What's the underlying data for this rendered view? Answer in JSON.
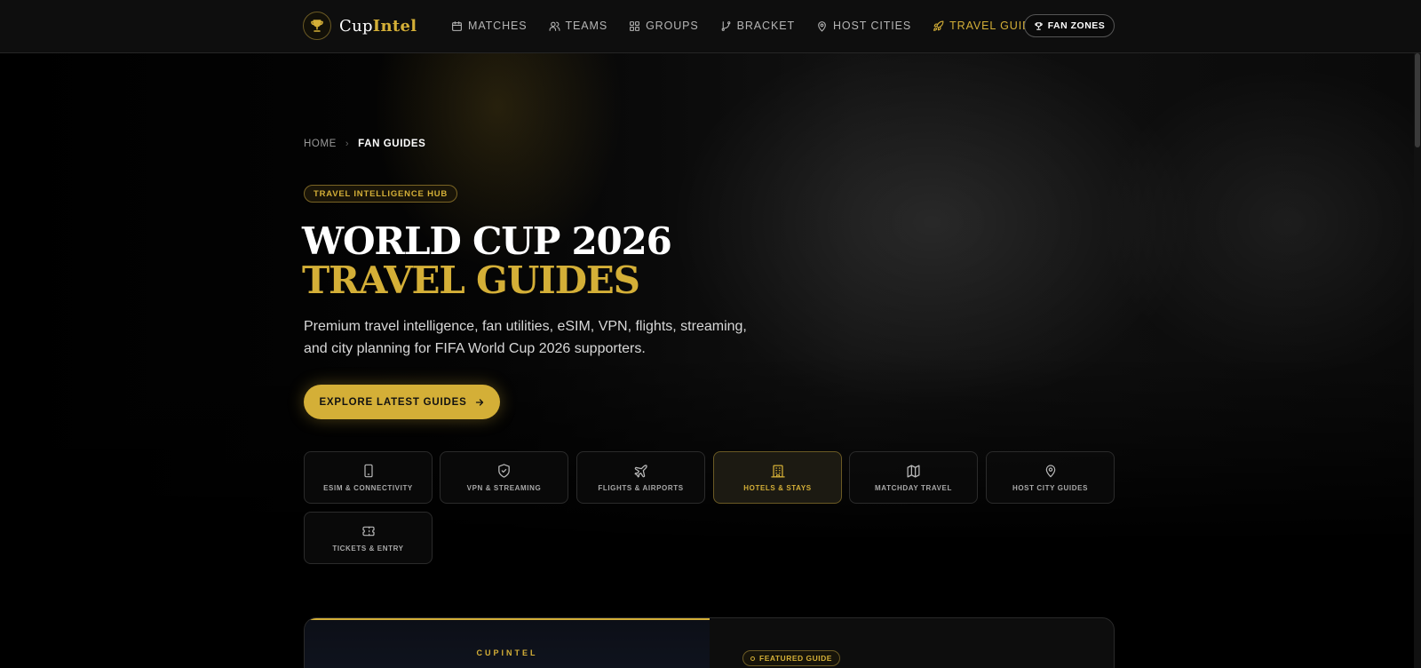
{
  "nav": {
    "logo": {
      "part1": "Cup",
      "part2": "Intel"
    },
    "links": [
      {
        "label": "MATCHES",
        "icon": "calendar-icon"
      },
      {
        "label": "TEAMS",
        "icon": "users-icon"
      },
      {
        "label": "GROUPS",
        "icon": "grid-icon"
      },
      {
        "label": "BRACKET",
        "icon": "bracket-icon"
      },
      {
        "label": "HOST CITIES",
        "icon": "map-pin-icon"
      },
      {
        "label": "TRAVEL GUIDES",
        "icon": "rocket-icon",
        "active": true
      }
    ],
    "cta": {
      "label": "FAN ZONES",
      "icon": "trophy-icon"
    }
  },
  "breadcrumb": {
    "home": "HOME",
    "separator": "›",
    "current": "FAN GUIDES"
  },
  "hero": {
    "badge": "TRAVEL INTELLIGENCE HUB",
    "title_line1": "WORLD CUP 2026",
    "title_line2": "TRAVEL GUIDES",
    "subtitle": "Premium travel intelligence, fan utilities, eSIM, VPN, flights, streaming, and city planning for FIFA World Cup 2026 supporters.",
    "cta_label": "EXPLORE LATEST GUIDES"
  },
  "categories": [
    {
      "label": "ESIM & CONNECTIVITY",
      "icon": "smartphone-icon"
    },
    {
      "label": "VPN & STREAMING",
      "icon": "shield-icon"
    },
    {
      "label": "FLIGHTS & AIRPORTS",
      "icon": "plane-icon"
    },
    {
      "label": "HOTELS & STAYS",
      "icon": "hotel-icon",
      "active": true
    },
    {
      "label": "MATCHDAY TRAVEL",
      "icon": "map-icon"
    },
    {
      "label": "HOST CITY GUIDES",
      "icon": "map-pin-icon"
    },
    {
      "label": "TICKETS & ENTRY",
      "icon": "ticket-icon"
    }
  ],
  "featured": {
    "brand": "CUPINTEL",
    "badge": "FEATURED GUIDE"
  },
  "colors": {
    "accent": "#d4af37",
    "background": "#000000",
    "nav_bg": "#0e0e0e"
  }
}
